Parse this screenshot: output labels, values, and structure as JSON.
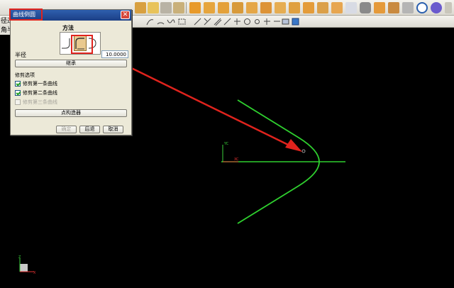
{
  "dialog": {
    "title": "曲线倒圆",
    "method_label": "方法",
    "radius_label": "半径",
    "radius_value": "10.0000",
    "inherit_button": "继承",
    "trim_options_label": "修剪选项",
    "trim_first": "修剪第一条曲线",
    "trim_second": "修剪第二条曲线",
    "trim_third": "修剪第三条曲线",
    "point_constructor_button": "点构造器",
    "ok_button": "确定",
    "back_button": "后退",
    "cancel_button": "取消",
    "close_glyph": "✕"
  },
  "side_labels": {
    "top": "径过",
    "bottom": "角半"
  },
  "checkbox_states": {
    "trim_first": true,
    "trim_second": true,
    "trim_third": false
  },
  "colors": {
    "annotation_red": "#e0231d",
    "curve_green": "#2fd02f",
    "titlebar_blue": "#1b3f86"
  },
  "wcs_labels": {
    "y": "YC",
    "x": "XC"
  },
  "corner_triad_labels": {
    "z": "Z",
    "x": "X"
  }
}
